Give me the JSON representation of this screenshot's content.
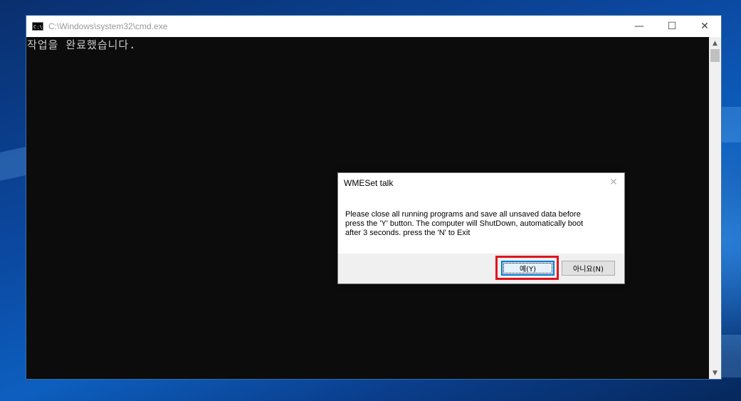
{
  "window": {
    "title": "C:\\Windows\\system32\\cmd.exe",
    "icon": "cmd-icon",
    "controls": {
      "minimize": "—",
      "maximize": "☐",
      "close": "✕"
    }
  },
  "console": {
    "lines": [
      "작업을 완료했습니다."
    ]
  },
  "scrollbar": {
    "up_arrow": "▲",
    "down_arrow": "▼"
  },
  "dialog": {
    "title": "WMESet talk",
    "close_glyph": "✕",
    "message": "Please close all running programs and save all unsaved data before\npress the 'Y' button. The computer will ShutDown, automatically boot\nafter 3 seconds.  press the 'N' to Exit",
    "yes_label": "예(Y)",
    "no_label": "아니요(N)"
  },
  "colors": {
    "highlight": "#e0141e",
    "console_bg": "#0c0c0c",
    "console_text": "#cccccc",
    "focus_accent": "#0078d7"
  }
}
